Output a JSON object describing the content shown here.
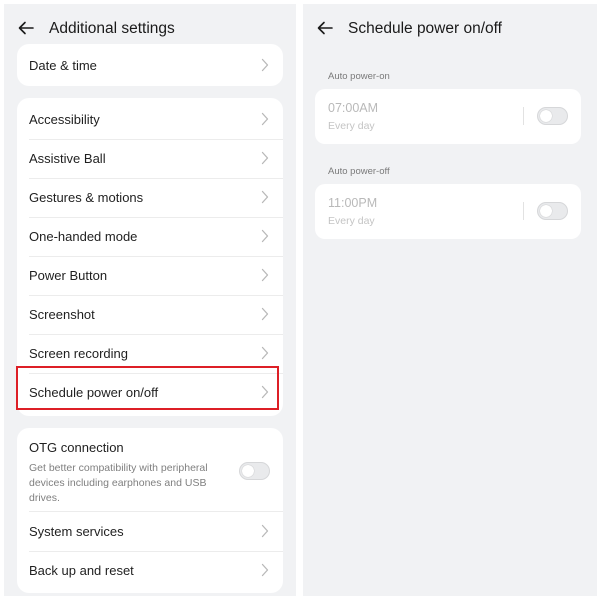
{
  "left_screen": {
    "title": "Additional settings",
    "groups": [
      {
        "items": [
          {
            "label": "Date & time"
          }
        ]
      },
      {
        "items": [
          {
            "label": "Accessibility"
          },
          {
            "label": "Assistive Ball"
          },
          {
            "label": "Gestures & motions"
          },
          {
            "label": "One-handed mode"
          },
          {
            "label": "Power Button"
          },
          {
            "label": "Screenshot"
          },
          {
            "label": "Screen recording"
          },
          {
            "label": "Schedule power on/off"
          }
        ]
      },
      {
        "items": [
          {
            "label": "OTG connection",
            "description": "Get better compatibility with peripheral devices including earphones and USB drives.",
            "toggle": false
          },
          {
            "label": "System services"
          },
          {
            "label": "Back up and reset"
          }
        ]
      }
    ]
  },
  "right_screen": {
    "title": "Schedule power on/off",
    "sections": [
      {
        "label": "Auto power-on",
        "time": "07:00AM",
        "repeat": "Every day",
        "enabled": false
      },
      {
        "label": "Auto power-off",
        "time": "11:00PM",
        "repeat": "Every day",
        "enabled": false
      }
    ]
  },
  "colors": {
    "highlight": "#dd1f26",
    "background": "#f1f2f4",
    "card": "#ffffff"
  },
  "icons": {
    "back": "back-arrow-icon",
    "chevron": "chevron-right-icon"
  }
}
